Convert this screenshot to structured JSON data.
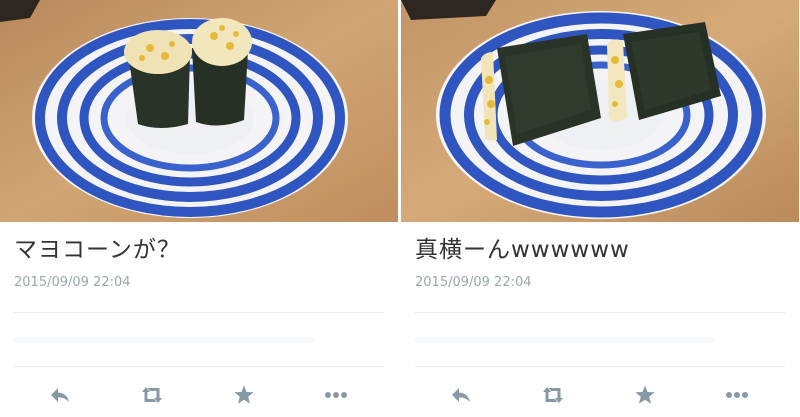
{
  "tweets": [
    {
      "text": "マヨコーンが？",
      "timestamp": "2015/09/09 22:04",
      "photo_description_icon": "sushi-photo-icon",
      "actions": [
        "reply-icon",
        "retweet-icon",
        "favorite-icon",
        "more-icon"
      ]
    },
    {
      "text": "真横ーんwwwwww",
      "timestamp": "2015/09/09 22:04",
      "photo_description_icon": "sushi-photo-icon",
      "actions": [
        "reply-icon",
        "retweet-icon",
        "favorite-icon",
        "more-icon"
      ]
    }
  ],
  "colors": {
    "plate_blue": "#2f55c0",
    "table_wood": "#c99a6a",
    "nori": "#2a3327",
    "icon": "#8899a6"
  }
}
